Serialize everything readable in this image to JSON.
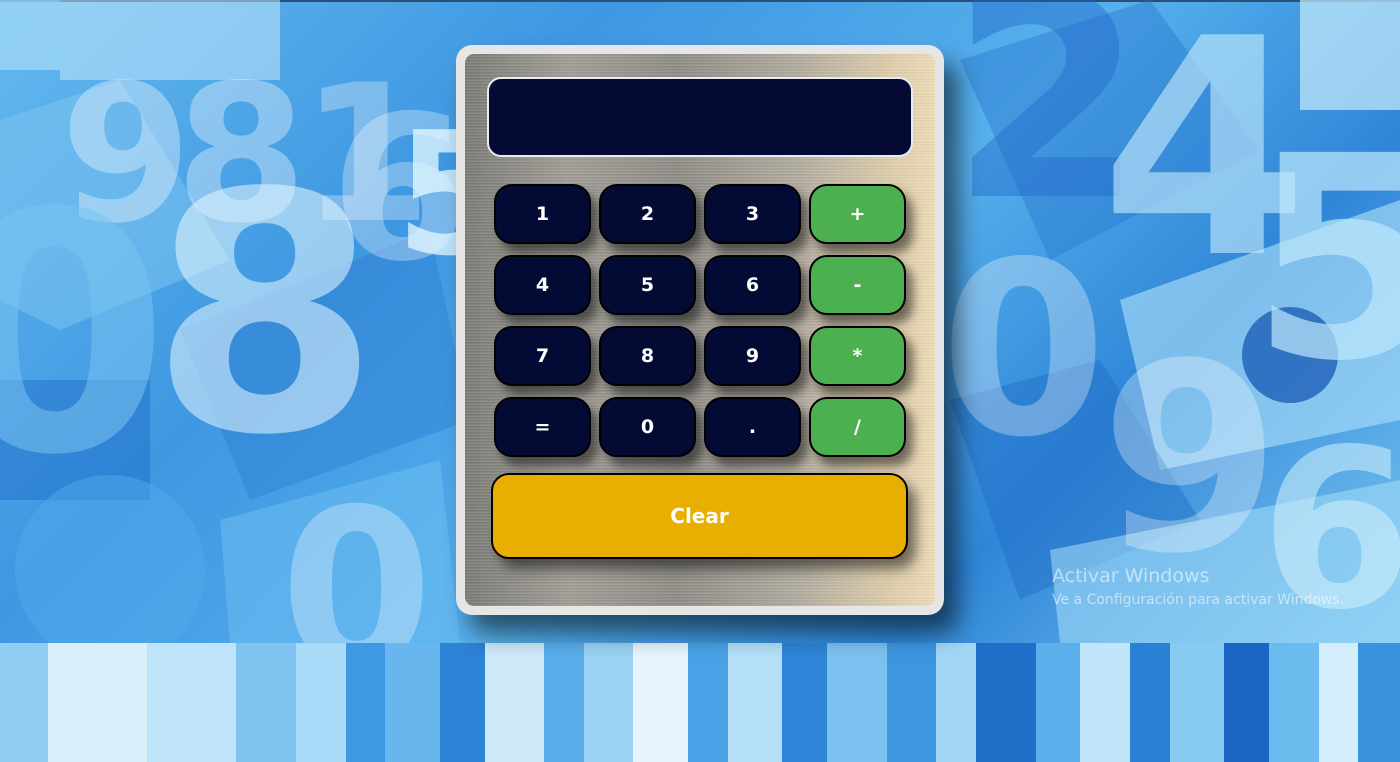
{
  "display": {
    "value": ""
  },
  "keypad": {
    "rows": [
      [
        "1",
        "2",
        "3",
        "+"
      ],
      [
        "4",
        "5",
        "6",
        "-"
      ],
      [
        "7",
        "8",
        "9",
        "*"
      ],
      [
        "=",
        "0",
        ".",
        "/"
      ]
    ]
  },
  "clear_label": "Clear",
  "watermark": {
    "title": "Activar Windows",
    "subtitle": "Ve a Configuración para activar Windows."
  },
  "colors": {
    "display_bg": "#040a33",
    "digit_key": "#030b35",
    "operator_key": "#4caf50",
    "clear_key": "#e9ae02",
    "key_text": "#ffffff"
  }
}
